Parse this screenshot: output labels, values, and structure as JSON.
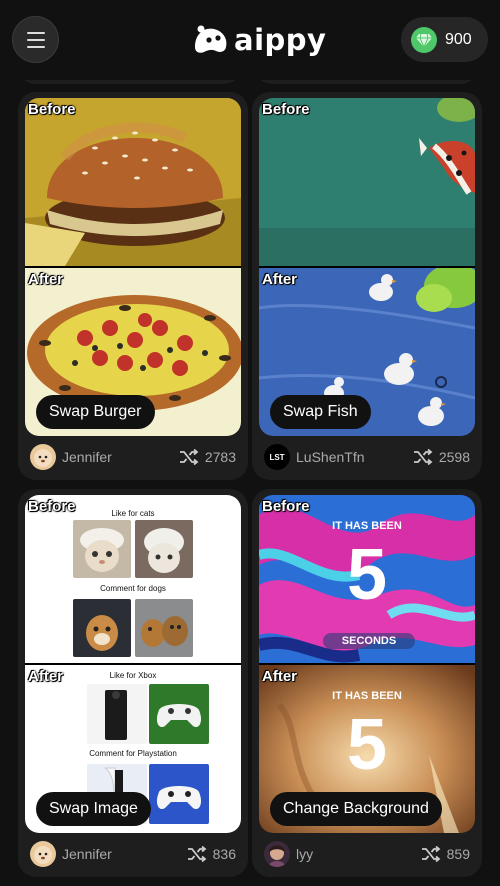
{
  "app": {
    "brand": "aippy",
    "credits": "900"
  },
  "cards": [
    {
      "before": "Before",
      "after": "After",
      "action": "Swap Burger",
      "user": "Jennifer",
      "remixes": "2783"
    },
    {
      "before": "Before",
      "after": "After",
      "action": "Swap Fish",
      "user": "LuShenTfn",
      "remixes": "2598",
      "avatar_text": "LST"
    },
    {
      "before": "Before",
      "after": "After",
      "action": "Swap Image",
      "user": "Jennifer",
      "remixes": "836",
      "before_top_caption": "Like for cats",
      "before_bottom_caption": "Comment for dogs",
      "after_top_caption": "Like for Xbox",
      "after_bottom_caption": "Comment for Playstation"
    },
    {
      "before": "Before",
      "after": "After",
      "action": "Change Background",
      "user": "lyy",
      "remixes": "859",
      "before_line1": "IT HAS BEEN",
      "before_number": "5",
      "before_line2": "SECONDS",
      "after_line1": "IT HAS BEEN",
      "after_number": "5"
    }
  ],
  "icons": [
    "menu-icon",
    "aippy-logo-icon",
    "gem-icon",
    "shuffle-icon"
  ],
  "colors": {
    "background": "#111111",
    "card": "#1e1e1e",
    "gem": "#4fc86a"
  }
}
